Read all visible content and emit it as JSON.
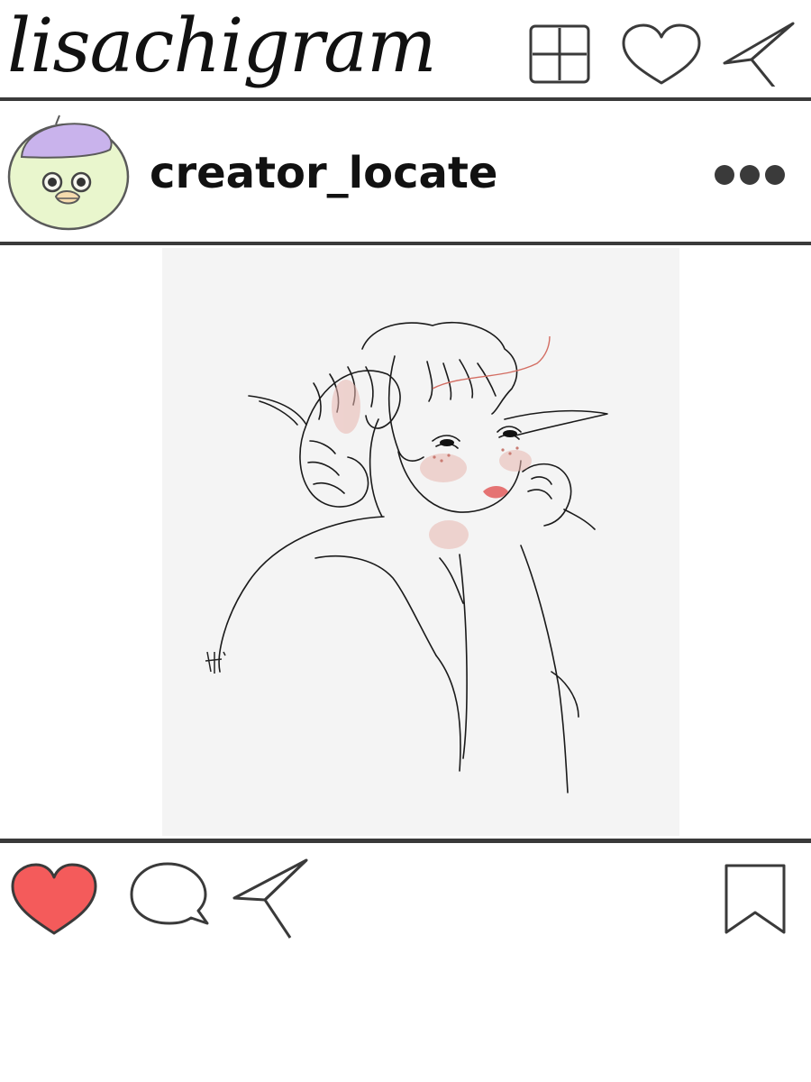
{
  "app": {
    "brand": "lisachigram"
  },
  "header_icons": [
    {
      "name": "new-post-icon"
    },
    {
      "name": "heart-icon"
    },
    {
      "name": "send-icon"
    }
  ],
  "post": {
    "username": "creator_locate",
    "avatar": {
      "name": "frog-with-purple-beret-avatar"
    },
    "image": {
      "name": "line-art-illustration-horned-girl"
    }
  },
  "actions": {
    "like": {
      "icon": "heart-icon",
      "state": "liked",
      "color": "#f45b5b"
    },
    "comment": {
      "icon": "comment-bubble-icon"
    },
    "share": {
      "icon": "paper-plane-icon"
    },
    "save": {
      "icon": "bookmark-icon"
    }
  },
  "colors": {
    "rule": "#3a3a3a",
    "liked_heart": "#f45b5b",
    "avatar_face": "#e9f6cd",
    "avatar_beret": "#c9b3ec",
    "image_background": "#f4f4f4"
  }
}
